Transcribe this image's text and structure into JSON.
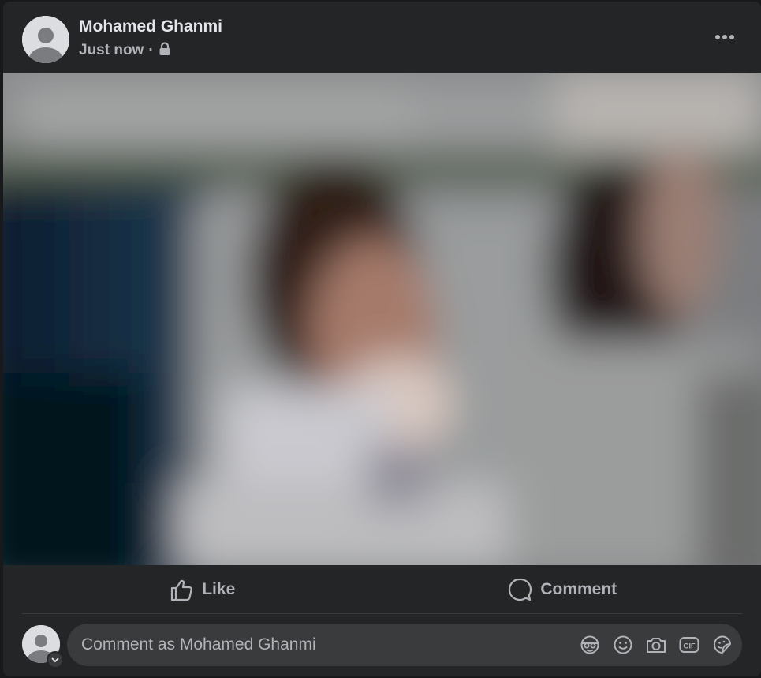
{
  "post": {
    "author_name": "Mohamed Ghanmi",
    "timestamp": "Just now",
    "separator": "·",
    "privacy_icon": "lock-icon",
    "more_icon": "more-horizontal-icon"
  },
  "actions": {
    "like_label": "Like",
    "like_icon": "thumbs-up-icon",
    "comment_label": "Comment",
    "comment_icon": "speech-bubble-icon"
  },
  "comment_box": {
    "placeholder": "Comment as Mohamed Ghanmi",
    "tools": [
      "avatar-sticker-icon",
      "emoji-icon",
      "camera-icon",
      "gif-icon",
      "sticker-icon"
    ]
  },
  "colors": {
    "card_background": "#242526",
    "page_background": "#18191a",
    "primary_text": "#e4e6eb",
    "secondary_text": "#b0b3b8",
    "input_background": "#3a3b3c"
  }
}
